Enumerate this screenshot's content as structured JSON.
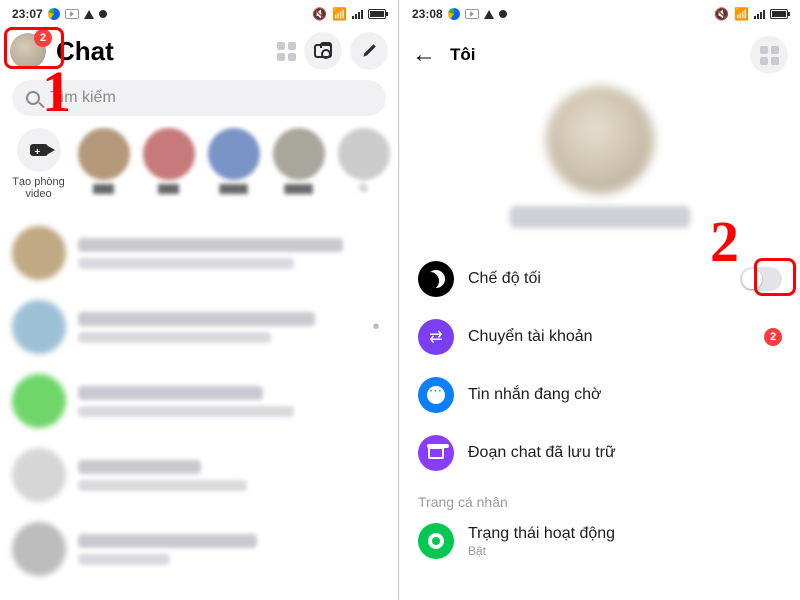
{
  "left": {
    "status": {
      "time": "23:07"
    },
    "header": {
      "title": "Chat",
      "avatar_badge": "2"
    },
    "search": {
      "placeholder": "Tìm kiếm"
    },
    "create_room": "Tạo phòng video"
  },
  "right": {
    "status": {
      "time": "23:08"
    },
    "header": {
      "title": "Tôi"
    },
    "settings": {
      "dark_mode": "Chế độ tối",
      "switch_account": "Chuyển tài khoản",
      "switch_badge": "2",
      "pending_msgs": "Tin nhắn đang chờ",
      "archived": "Đoạn chat đã lưu trữ",
      "section": "Trang cá nhân",
      "active_status": "Trạng thái hoạt động",
      "active_sub": "Bật"
    }
  },
  "annotations": {
    "num1": "1",
    "num2": "2"
  }
}
